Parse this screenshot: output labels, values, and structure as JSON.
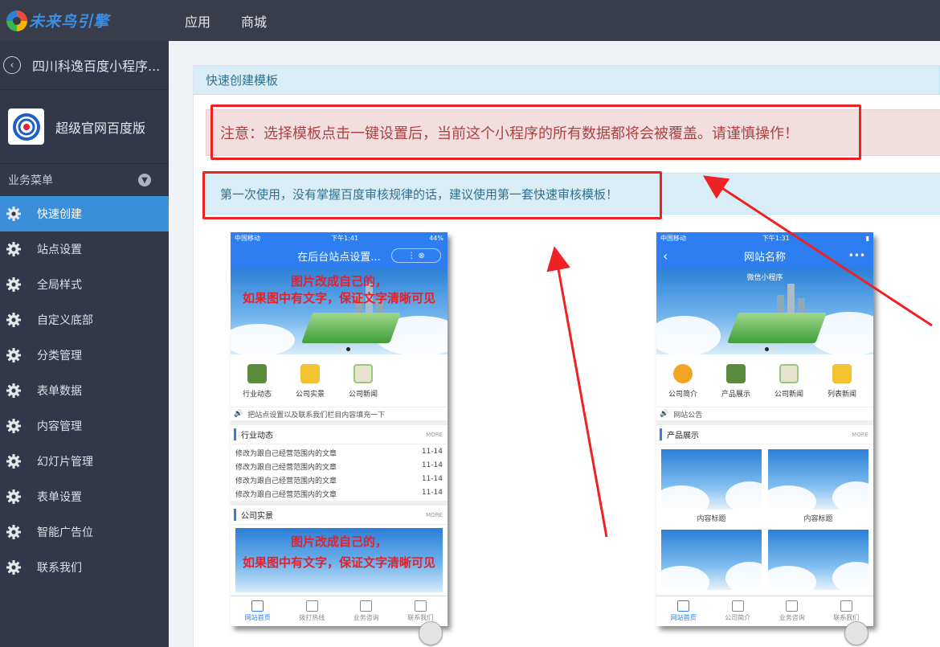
{
  "topbar": {
    "logo_text": "未来鸟引擎",
    "nav": [
      "应用",
      "商城"
    ]
  },
  "sidebar": {
    "app_title": "四川科逸百度小程序...",
    "product_name": "超级官网百度版",
    "menu_heading": "业务菜单",
    "items": [
      {
        "label": "快速创建",
        "active": true
      },
      {
        "label": "站点设置"
      },
      {
        "label": "全局样式"
      },
      {
        "label": "自定义底部"
      },
      {
        "label": "分类管理"
      },
      {
        "label": "表单数据"
      },
      {
        "label": "内容管理"
      },
      {
        "label": "幻灯片管理"
      },
      {
        "label": "表单设置"
      },
      {
        "label": "智能广告位"
      },
      {
        "label": "联系我们"
      }
    ]
  },
  "main": {
    "panel_title": "快速创建模板",
    "warning": "注意：选择模板点击一键设置后，当前这个小程序的所有数据都将会被覆盖。请谨慎操作！",
    "tip": "第一次使用，没有掌握百度审核规律的话，建议使用第一套快速审核模板！"
  },
  "template1": {
    "status_left": "中国移动",
    "status_time": "下午1:41",
    "status_right": "44%",
    "nav_title": "在后台站点设置...",
    "banner_line1": "图片改成自己的，",
    "banner_line2": "如果图中有文字，保证文字清晰可见",
    "icons": [
      "行业动态",
      "公司实景",
      "公司新闻"
    ],
    "notice": "把站点设置以及联系我们栏目内容填充一下",
    "section1": "行业动态",
    "more": "MORE",
    "news": [
      {
        "title": "修改为跟自己经营范围内的文章",
        "date": "11-14"
      },
      {
        "title": "修改为跟自己经营范围内的文章",
        "date": "11-14"
      },
      {
        "title": "修改为跟自己经营范围内的文章",
        "date": "11-14"
      },
      {
        "title": "修改为跟自己经营范围内的文章",
        "date": "11-14"
      }
    ],
    "section2": "公司实景",
    "tabs": [
      "网站首页",
      "拨打热线",
      "业务咨询",
      "联系我们"
    ]
  },
  "template2": {
    "status_left": "中国移动",
    "status_time": "下午1:31",
    "nav_title": "网站名称",
    "banner_caption": "微信小程序",
    "icons": [
      "公司简介",
      "产品展示",
      "公司新闻",
      "列表新闻"
    ],
    "notice": "网站公告",
    "section1": "产品展示",
    "more": "MORE",
    "grid_caption": "内容标题",
    "tabs": [
      "网站首页",
      "公司简介",
      "业务咨询",
      "联系我们"
    ]
  },
  "colors": {
    "accent": "#3b8fd9",
    "topbar": "#393d49",
    "sidebar": "#32374a",
    "annotation": "#ee2222"
  }
}
